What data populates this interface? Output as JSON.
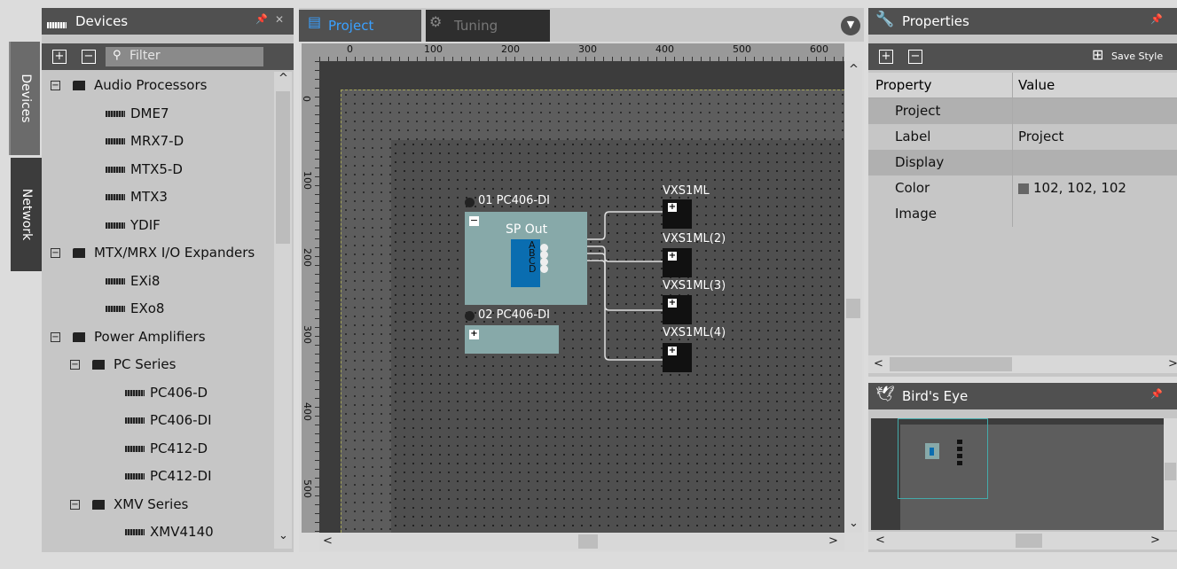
{
  "devices_panel": {
    "title": "Devices",
    "filter_placeholder": "Filter",
    "side_tabs": [
      "Devices",
      "Network"
    ],
    "tree": [
      {
        "label": "Audio Processors",
        "type": "folder",
        "level": 0,
        "exp": "⊟"
      },
      {
        "label": "DME7",
        "type": "device",
        "level": 1
      },
      {
        "label": "MRX7-D",
        "type": "device",
        "level": 1
      },
      {
        "label": "MTX5-D",
        "type": "device",
        "level": 1
      },
      {
        "label": "MTX3",
        "type": "device",
        "level": 1
      },
      {
        "label": "YDIF",
        "type": "device",
        "level": 1
      },
      {
        "label": "MTX/MRX I/O Expanders",
        "type": "folder",
        "level": 0,
        "exp": "⊟"
      },
      {
        "label": "EXi8",
        "type": "device",
        "level": 1
      },
      {
        "label": "EXo8",
        "type": "device",
        "level": 1
      },
      {
        "label": "Power Amplifiers",
        "type": "folder",
        "level": 0,
        "exp": "⊟"
      },
      {
        "label": "PC Series",
        "type": "folder",
        "level": 1,
        "exp": "⊟"
      },
      {
        "label": "PC406-D",
        "type": "device",
        "level": 2
      },
      {
        "label": "PC406-DI",
        "type": "device",
        "level": 2
      },
      {
        "label": "PC412-D",
        "type": "device",
        "level": 2
      },
      {
        "label": "PC412-DI",
        "type": "device",
        "level": 2
      },
      {
        "label": "XMV Series",
        "type": "folder",
        "level": 1,
        "exp": "⊟"
      },
      {
        "label": "XMV4140",
        "type": "device",
        "level": 2
      }
    ]
  },
  "tabs": [
    {
      "label": "Project",
      "active": true
    },
    {
      "label": "Tuning",
      "active": false
    }
  ],
  "canvas": {
    "ruler_h": [
      "0",
      "100",
      "200",
      "300",
      "400",
      "500",
      "600"
    ],
    "ruler_v": [
      "0",
      "100",
      "200",
      "300",
      "400",
      "500"
    ],
    "amp1": {
      "name": "01 PC406-DI",
      "block_label": "SP Out",
      "ports": [
        "A",
        "B",
        "C",
        "D"
      ]
    },
    "amp2": {
      "name": "02 PC406-DI"
    },
    "speakers": [
      "VXS1ML",
      "VXS1ML(2)",
      "VXS1ML(3)",
      "VXS1ML(4)"
    ]
  },
  "properties_panel": {
    "title": "Properties",
    "save_style": "Save Style",
    "col_property": "Property",
    "col_value": "Value",
    "rows": [
      {
        "property": "Project",
        "value": "",
        "category": true
      },
      {
        "property": "Label",
        "value": "Project",
        "category": false
      },
      {
        "property": "Display",
        "value": "",
        "category": true
      },
      {
        "property": "Color",
        "value": "102, 102, 102",
        "category": false,
        "swatch": "#666666"
      },
      {
        "property": "Image",
        "value": "",
        "category": false
      }
    ]
  },
  "birds_eye": {
    "title": "Bird's Eye"
  },
  "colors": {
    "accent_blue": "#0a6db0",
    "panel_header": "#505050",
    "amp_block": "#87a9a9"
  }
}
